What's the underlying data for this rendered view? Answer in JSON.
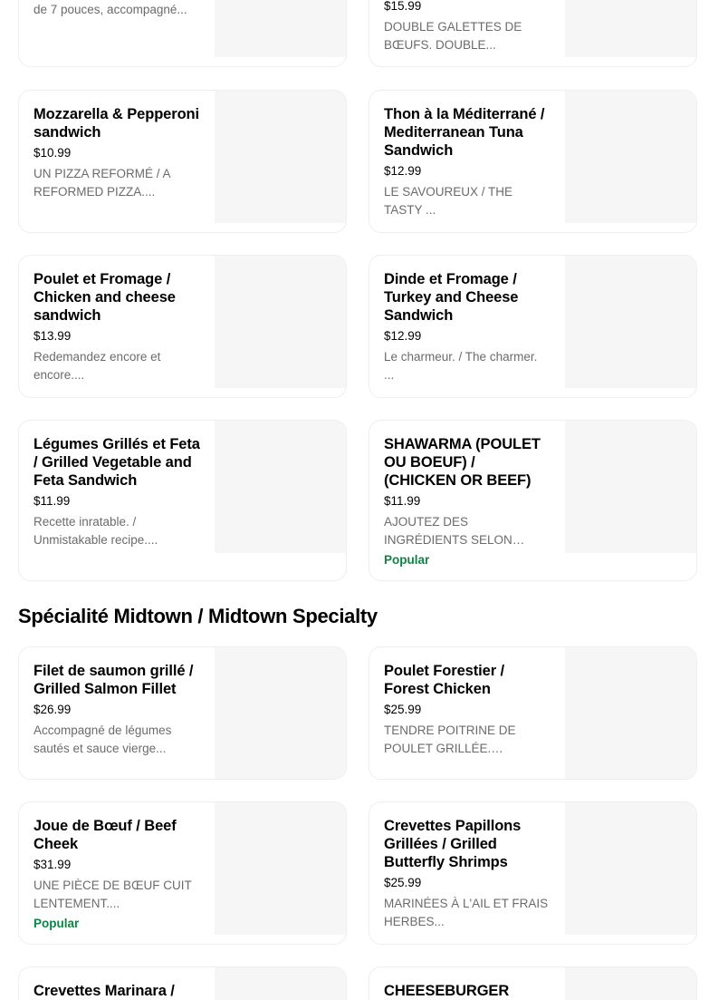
{
  "top_partial": {
    "left_desc": "de 7 pouces, accompagné...",
    "right_price": "$15.99",
    "right_desc": "DOUBLE GALETTES DE BŒUFS. DOUBLE..."
  },
  "items": [
    {
      "name": "Mozzarella & Pepperoni sandwich",
      "price": "$10.99",
      "desc": "UN PIZZA REFORMÉ / A REFORMED PIZZA....",
      "badge": ""
    },
    {
      "name": "Thon à la Méditerrané / Mediterranean Tuna Sandwich",
      "price": "$12.99",
      "desc": "LE SAVOUREUX / THE TASTY ...",
      "badge": ""
    },
    {
      "name": "Poulet et Fromage / Chicken and cheese sandwich",
      "price": "$13.99",
      "desc": "Redemandez encore et encore....",
      "badge": ""
    },
    {
      "name": "Dinde et Fromage / Turkey and Cheese Sandwich",
      "price": "$12.99",
      "desc": "Le charmeur. / The charmer. ...",
      "badge": ""
    },
    {
      "name": "Légumes Grillés et Feta / Grilled Vegetable and Feta Sandwich",
      "price": "$11.99",
      "desc": "Recette inratable. / Unmistakable recipe....",
      "badge": ""
    },
    {
      "name": "SHAWARMA (POULET OU BOEUF) / (CHICKEN OR BEEF)",
      "price": "$11.99",
      "desc": "AJOUTEZ DES INGRÉDIENTS SELON VOTRE GOÛT. / ADD...",
      "badge": "Popular"
    }
  ],
  "section": {
    "title": "Spécialité Midtown / Midtown Specialty"
  },
  "specialty_items": [
    {
      "name": "Filet de saumon grillé / Grilled Salmon Fillet",
      "price": "$26.99",
      "desc": "Accompagné de légumes sautés et sauce vierge...",
      "badge": ""
    },
    {
      "name": "Poulet Forestier / Forest Chicken",
      "price": "$25.99",
      "desc": "TENDRE POITRINE DE POULET GRILLÉE. NAPPÉE...",
      "badge": ""
    },
    {
      "name": "Joue de Bœuf / Beef Cheek",
      "price": "$31.99",
      "desc": "UNE PIÈCE DE BŒUF CUIT LENTEMENT....",
      "badge": "Popular"
    },
    {
      "name": "Crevettes Papillons Grillées  / Grilled Butterfly Shrimps",
      "price": "$25.99",
      "desc": "MARINÉES À L'AIL ET FRAIS HERBES...",
      "badge": ""
    }
  ],
  "bottom_partial": {
    "left_name": "Crevettes Marinara /",
    "right_name": "CHEESEBURGER"
  },
  "colors": {
    "popular_badge": "#0e8345",
    "description": "#6b6b6b",
    "card_border": "#eeeeee",
    "thumbnail_bg": "#f6f6f6"
  }
}
